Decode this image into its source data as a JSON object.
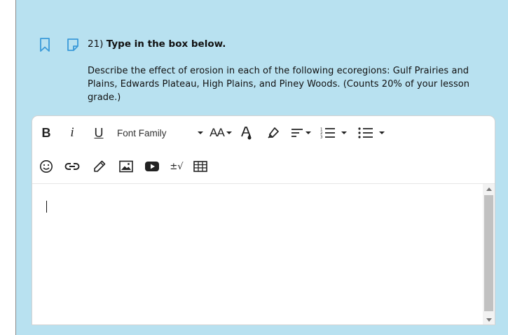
{
  "question": {
    "number": "21)",
    "instruction": "Type in the box below.",
    "prompt": "Describe the effect of erosion in each of the following ecoregions: Gulf Prairies and Plains, Edwards Plateau, High Plains, and Piney Woods. (Counts 20% of your lesson grade.)"
  },
  "toolbar": {
    "bold_label": "B",
    "italic_label": "i",
    "underline_label": "U",
    "font_family_label": "Font Family",
    "font_size_label": "AA",
    "special_char_label": "±√"
  },
  "icons": {
    "bookmark": "bookmark-icon",
    "note": "note-icon",
    "text_color": "text-color-icon",
    "highlight": "highlighter-icon",
    "align": "align-icon",
    "ordered_list": "ordered-list-icon",
    "unordered_list": "unordered-list-icon",
    "emoticon": "smiley-icon",
    "link": "link-icon",
    "draw": "pencil-icon",
    "image": "image-icon",
    "video": "video-icon",
    "math": "math-icon",
    "table": "table-icon"
  },
  "colors": {
    "panel_bg": "#b8e1f0",
    "accent_icon": "#3a9ad9"
  }
}
